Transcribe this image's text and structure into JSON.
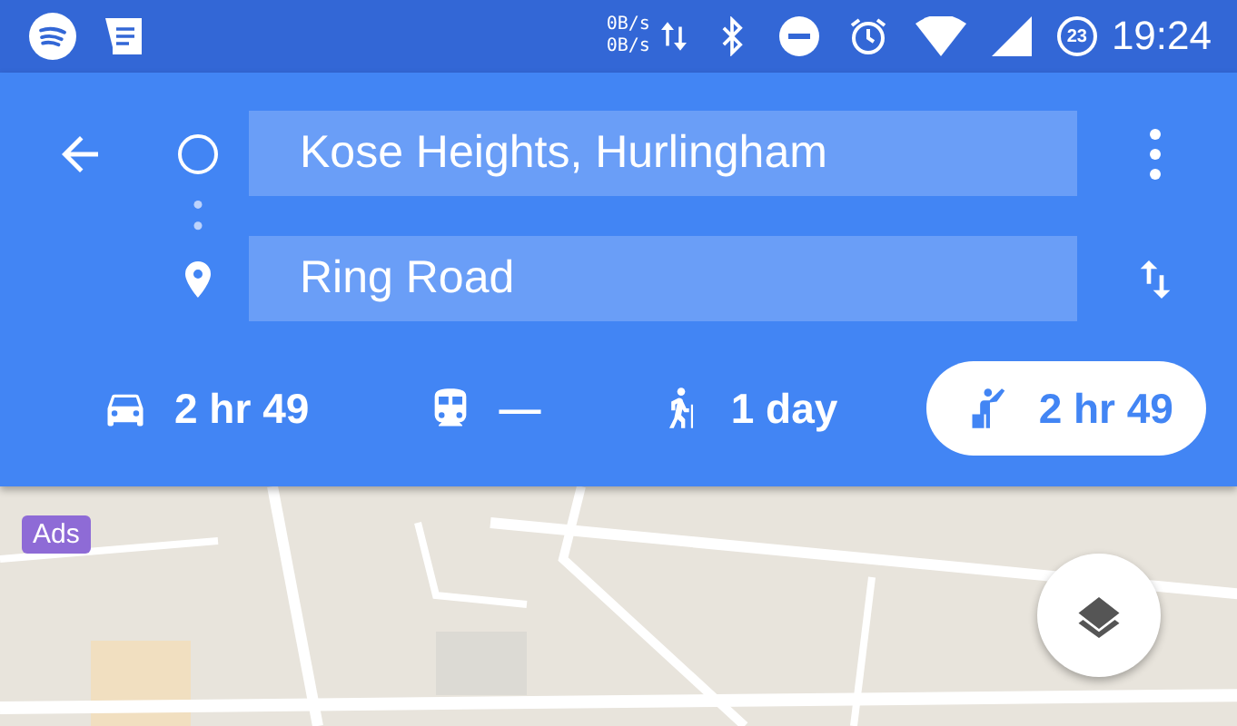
{
  "status_bar": {
    "net_rates": [
      "0B/s",
      "0B/s"
    ],
    "battery": "23",
    "time": "19:24"
  },
  "route": {
    "origin": "Kose Heights, Hurlingham",
    "destination": "Ring Road"
  },
  "modes": [
    {
      "kind": "car",
      "label": "2 hr 49",
      "selected": false
    },
    {
      "kind": "transit",
      "label": "—",
      "selected": false
    },
    {
      "kind": "walk",
      "label": "1 day",
      "selected": false
    },
    {
      "kind": "ride",
      "label": "2 hr 49",
      "selected": true
    }
  ],
  "map": {
    "badge": "Ads"
  }
}
